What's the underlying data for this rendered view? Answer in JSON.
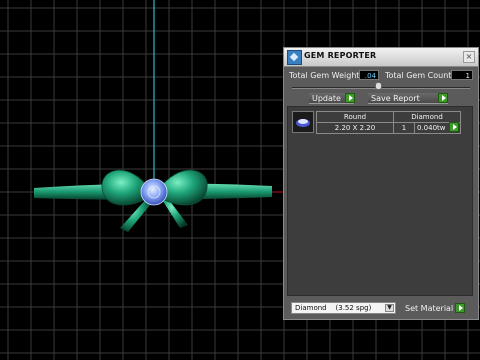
{
  "panel": {
    "title": "GEM REPORTER",
    "close_glyph": "×",
    "total_weight_label": "Total Gem Weight",
    "total_weight_value": ".04",
    "total_count_label": "Total Gem Count",
    "total_count_value": "1",
    "update_label": "Update",
    "save_report_label": "Save Report",
    "table": {
      "headers": [
        "Round",
        "Diamond"
      ],
      "size": "2.20 X 2.20",
      "count": "1",
      "weight": "0.040tw"
    },
    "material_select": "Diamond    (3.52 spg)",
    "set_material_label": "Set Material"
  },
  "colors": {
    "panel_bg": "#5b5b5b",
    "go_button": "#3e9a2a",
    "bow_green": "#1fa57a",
    "gem_blue": "#7f9ff0",
    "grid_line": "#3a3a3a",
    "axis_cyan": "#2fb7c8"
  },
  "icons": [
    "gem-reporter-icon",
    "close-icon",
    "gem-thumbnail-icon",
    "dropdown-arrow-icon",
    "play-arrow-icon"
  ]
}
